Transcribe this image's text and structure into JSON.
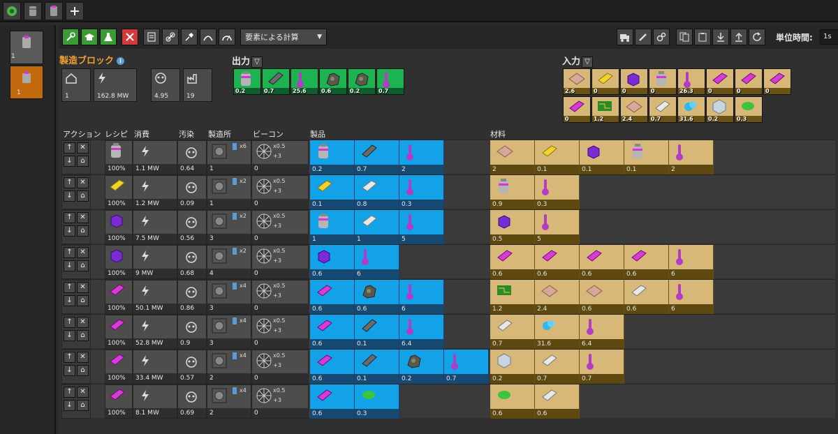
{
  "window": {
    "title": ""
  },
  "topbar": {
    "icons": [
      "green-cycle-icon",
      "barrel-icon",
      "barrel-icon",
      "plus-icon"
    ]
  },
  "left": {
    "blocks": [
      {
        "value": "1"
      },
      {
        "value": "1"
      }
    ]
  },
  "toolbar": {
    "mode_label": "要素による計算",
    "unit_label": "単位時間:",
    "unit_value": "1s"
  },
  "block": {
    "title": "製造ブロック",
    "stats": [
      {
        "icon": "building-icon",
        "value": "1"
      },
      {
        "icon": "power-icon",
        "value": "162.8 MW"
      },
      {
        "icon": "pollution-icon",
        "value": "4.95"
      },
      {
        "icon": "factory-icon",
        "value": "19"
      }
    ]
  },
  "outputs": {
    "label": "出力",
    "items": [
      {
        "icon": "barrel-icon",
        "value": "0.2"
      },
      {
        "icon": "plate-icon",
        "value": "0.7"
      },
      {
        "icon": "thermometer-icon",
        "value": "25.6"
      },
      {
        "icon": "ore-icon",
        "value": "0.6"
      },
      {
        "icon": "ore-icon",
        "value": "0.2"
      },
      {
        "icon": "thermometer-icon",
        "value": "0.7"
      }
    ]
  },
  "inputs": {
    "label": "入力",
    "items": [
      {
        "icon": "copper-plate-icon",
        "value": "2.6"
      },
      {
        "icon": "yellow-block-icon",
        "value": "0"
      },
      {
        "icon": "purple-cube-icon",
        "value": "0"
      },
      {
        "icon": "barrel-icon",
        "value": "0"
      },
      {
        "icon": "thermometer-icon",
        "value": "26.3"
      },
      {
        "icon": "pink-block-icon",
        "value": "0"
      },
      {
        "icon": "pink-block-icon",
        "value": "0"
      },
      {
        "icon": "pink-block-icon",
        "value": "0"
      },
      {
        "icon": "pink-block-icon",
        "value": "0"
      },
      {
        "icon": "circuit-icon",
        "value": "1.2"
      },
      {
        "icon": "copper-plate-icon",
        "value": "2.4"
      },
      {
        "icon": "white-block-icon",
        "value": "0.7"
      },
      {
        "icon": "blue-crystal-icon",
        "value": "31.6"
      },
      {
        "icon": "hexagon-icon",
        "value": "0.2"
      },
      {
        "icon": "green-blob-icon",
        "value": "0.3"
      }
    ]
  },
  "table": {
    "headers": [
      "アクション",
      "レシピ",
      "消費",
      "汚染",
      "製造所",
      "ビーコン",
      "製品",
      "材料"
    ],
    "rows": [
      {
        "recipe_icon": "barrel-icon",
        "recipe_pct": "100%",
        "power": "1.1 MW",
        "pollution": "0.64",
        "factory_count": "1",
        "factory_mult": "x6",
        "beacon_mult": "x0.5",
        "beacon_plus": "+3",
        "beacon_count": "0",
        "products": [
          {
            "icon": "barrel-icon",
            "v": "0.2"
          },
          {
            "icon": "plate-icon",
            "v": "0.7"
          },
          {
            "icon": "thermometer-icon",
            "v": "2"
          }
        ],
        "materials": [
          {
            "icon": "copper-plate-icon",
            "v": "2"
          },
          {
            "icon": "yellow-block-icon",
            "v": "0.1"
          },
          {
            "icon": "purple-cube-icon",
            "v": "0.1"
          },
          {
            "icon": "barrel-icon",
            "v": "0.1"
          },
          {
            "icon": "thermometer-icon",
            "v": "2"
          }
        ]
      },
      {
        "recipe_icon": "yellow-block-icon",
        "recipe_pct": "100%",
        "power": "1.2 MW",
        "pollution": "0.09",
        "factory_count": "1",
        "factory_mult": "x2",
        "beacon_mult": "x0.5",
        "beacon_plus": "+3",
        "beacon_count": "0",
        "products": [
          {
            "icon": "yellow-block-icon",
            "v": "0.1"
          },
          {
            "icon": "white-block-icon",
            "v": "0.8"
          },
          {
            "icon": "thermometer-icon",
            "v": "0.3"
          }
        ],
        "materials": [
          {
            "icon": "barrel-icon",
            "v": "0.9"
          },
          {
            "icon": "thermometer-icon",
            "v": "0.3"
          }
        ]
      },
      {
        "recipe_icon": "purple-cube-icon",
        "recipe_pct": "100%",
        "power": "7.5 MW",
        "pollution": "0.56",
        "factory_count": "3",
        "factory_mult": "x2",
        "beacon_mult": "x0.5",
        "beacon_plus": "+3",
        "beacon_count": "0",
        "products": [
          {
            "icon": "barrel-icon",
            "v": "1"
          },
          {
            "icon": "white-block-icon",
            "v": "1"
          },
          {
            "icon": "thermometer-icon",
            "v": "5"
          }
        ],
        "materials": [
          {
            "icon": "purple-cube-icon",
            "v": "0.5"
          },
          {
            "icon": "thermometer-icon",
            "v": "5"
          }
        ]
      },
      {
        "recipe_icon": "purple-cube-icon",
        "recipe_pct": "100%",
        "power": "9 MW",
        "pollution": "0.68",
        "factory_count": "4",
        "factory_mult": "x2",
        "beacon_mult": "x0.5",
        "beacon_plus": "+3",
        "beacon_count": "0",
        "products": [
          {
            "icon": "purple-cube-icon",
            "v": "0.6"
          },
          {
            "icon": "thermometer-icon",
            "v": "6"
          }
        ],
        "materials": [
          {
            "icon": "pink-block-icon",
            "v": "0.6"
          },
          {
            "icon": "pink-block-icon",
            "v": "0.6"
          },
          {
            "icon": "pink-block-icon",
            "v": "0.6"
          },
          {
            "icon": "pink-block-icon",
            "v": "0.6"
          },
          {
            "icon": "thermometer-icon",
            "v": "6"
          }
        ]
      },
      {
        "recipe_icon": "pink-block-icon",
        "recipe_pct": "100%",
        "power": "50.1 MW",
        "pollution": "0.86",
        "factory_count": "3",
        "factory_mult": "x4",
        "beacon_mult": "x0.5",
        "beacon_plus": "+3",
        "beacon_count": "0",
        "products": [
          {
            "icon": "pink-block-icon",
            "v": "0.6"
          },
          {
            "icon": "ore-icon",
            "v": "0.6"
          },
          {
            "icon": "thermometer-icon",
            "v": "6"
          }
        ],
        "materials": [
          {
            "icon": "circuit-icon",
            "v": "1.2"
          },
          {
            "icon": "copper-plate-icon",
            "v": "2.4"
          },
          {
            "icon": "copper-plate-icon",
            "v": "0.6"
          },
          {
            "icon": "white-block-icon",
            "v": "0.6"
          },
          {
            "icon": "thermometer-icon",
            "v": "6"
          }
        ]
      },
      {
        "recipe_icon": "pink-block-icon",
        "recipe_pct": "100%",
        "power": "52.8 MW",
        "pollution": "0.9",
        "factory_count": "3",
        "factory_mult": "x4",
        "beacon_mult": "x0.5",
        "beacon_plus": "+3",
        "beacon_count": "0",
        "products": [
          {
            "icon": "pink-block-icon",
            "v": "0.6"
          },
          {
            "icon": "plate-icon",
            "v": "0.1"
          },
          {
            "icon": "thermometer-icon",
            "v": "6.4"
          }
        ],
        "materials": [
          {
            "icon": "white-block-icon",
            "v": "0.7"
          },
          {
            "icon": "blue-crystal-icon",
            "v": "31.6"
          },
          {
            "icon": "thermometer-icon",
            "v": "6.4"
          }
        ]
      },
      {
        "recipe_icon": "pink-block-icon",
        "recipe_pct": "100%",
        "power": "33.4 MW",
        "pollution": "0.57",
        "factory_count": "2",
        "factory_mult": "x4",
        "beacon_mult": "x0.5",
        "beacon_plus": "+3",
        "beacon_count": "0",
        "products": [
          {
            "icon": "pink-block-icon",
            "v": "0.6"
          },
          {
            "icon": "plate-icon",
            "v": "0.1"
          },
          {
            "icon": "ore-icon",
            "v": "0.2"
          },
          {
            "icon": "thermometer-icon",
            "v": "0.7"
          }
        ],
        "materials": [
          {
            "icon": "hexagon-icon",
            "v": "0.2"
          },
          {
            "icon": "white-block-icon",
            "v": "0.7"
          },
          {
            "icon": "thermometer-icon",
            "v": "0.7"
          }
        ]
      },
      {
        "recipe_icon": "pink-block-icon",
        "recipe_pct": "100%",
        "power": "8.1 MW",
        "pollution": "0.69",
        "factory_count": "2",
        "factory_mult": "x4",
        "beacon_mult": "x0.5",
        "beacon_plus": "+3",
        "beacon_count": "0",
        "products": [
          {
            "icon": "pink-block-icon",
            "v": "0.6"
          },
          {
            "icon": "green-blob-icon",
            "v": "0.3"
          }
        ],
        "materials": [
          {
            "icon": "green-blob-icon",
            "v": "0.6"
          },
          {
            "icon": "white-block-icon",
            "v": "0.6"
          }
        ]
      }
    ]
  },
  "colors": {
    "product_bg": "#13a2e8",
    "material_bg": "#d8b878",
    "output_bg": "#1db350",
    "accent_orange": "#f0a030"
  }
}
